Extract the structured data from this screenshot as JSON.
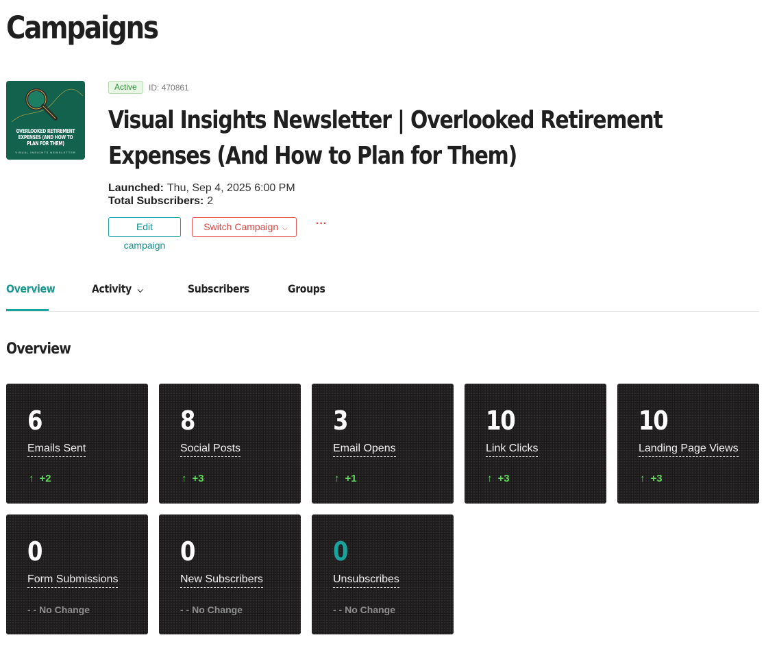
{
  "page": {
    "title": "Campaigns"
  },
  "campaign": {
    "thumbnail": {
      "title_lines": "OVERLOOKED RETIREMENT EXPENSES (AND HOW TO PLAN FOR THEM)",
      "subtitle": "VISUAL INSIGHTS NEWSLETTER",
      "background": "#12624d",
      "icon": "magnifying-glass-icon"
    },
    "status": "Active",
    "id_text": "ID: 470861",
    "title": "Visual Insights Newsletter | Overlooked Retirement Expenses (And How to Plan for Them)",
    "launched_label": "Launched:",
    "launched_value": "Thu, Sep 4, 2025 6:00 PM",
    "subscribers_label": "Total Subscribers:",
    "subscribers_value": "2",
    "edit_label": "Edit campaign",
    "switch_label": "Switch Campaign",
    "more_label": "···"
  },
  "tabs": [
    {
      "label": "Overview",
      "active": true
    },
    {
      "label": "Activity",
      "active": false,
      "has_dropdown": true
    },
    {
      "label": "Subscribers",
      "active": false
    },
    {
      "label": "Groups",
      "active": false
    }
  ],
  "overview": {
    "section_title": "Overview",
    "cards": [
      {
        "value": "6",
        "label": "Emails Sent",
        "change": "+2"
      },
      {
        "value": "8",
        "label": "Social Posts",
        "change": "+3"
      },
      {
        "value": "3",
        "label": "Email Opens",
        "change": "+1"
      },
      {
        "value": "10",
        "label": "Link Clicks",
        "change": "+3"
      },
      {
        "value": "10",
        "label": "Landing Page Views",
        "change": "+3"
      },
      {
        "value": "0",
        "label": "Form Submissions",
        "change": "- - No Change"
      },
      {
        "value": "0",
        "label": "New Subscribers",
        "change": "- - No Change"
      },
      {
        "value": "0",
        "label": "Unsubscribes",
        "change": "- - No Change",
        "value_color": "#1aa39d"
      }
    ]
  },
  "colors": {
    "accent_teal": "#1aa39d",
    "danger_red": "#d94442",
    "positive_green": "#5fd65b",
    "card_background": "#232122"
  }
}
